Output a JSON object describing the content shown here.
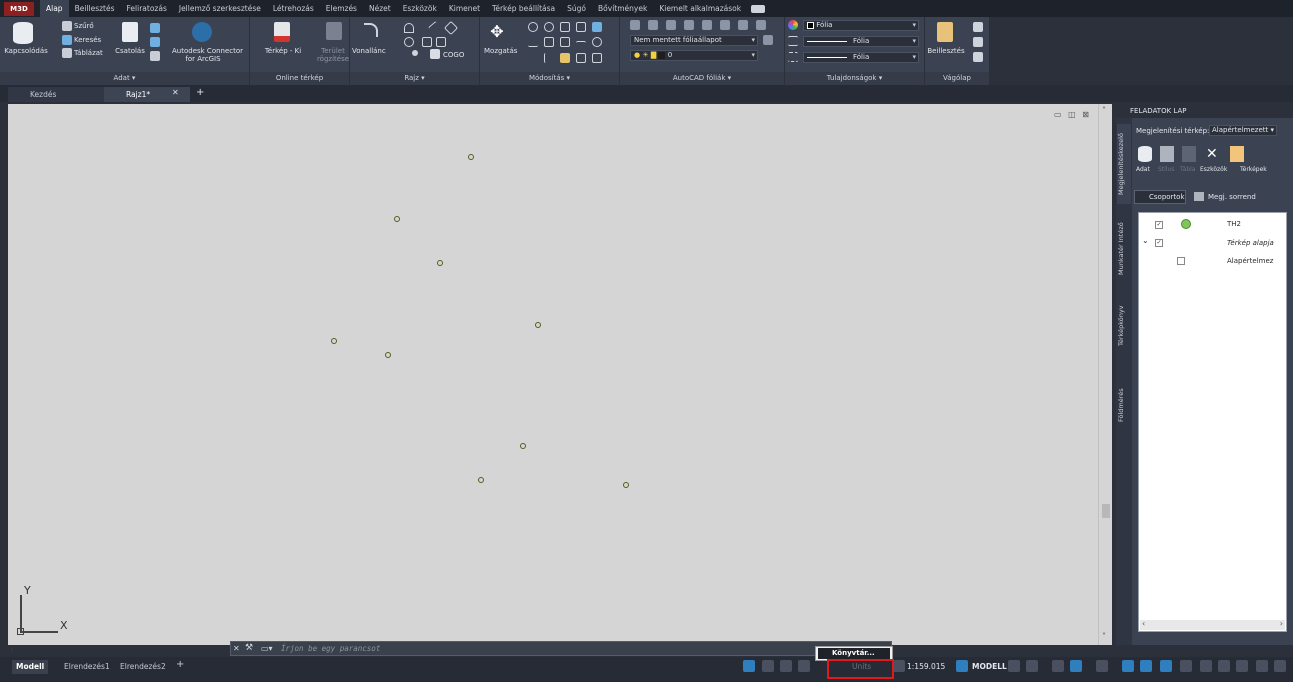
{
  "app": {
    "button_label": "M3D"
  },
  "ribbon_tabs": [
    "Alap",
    "Beillesztés",
    "Feliratozás",
    "Jellemző szerkesztése",
    "Létrehozás",
    "Elemzés",
    "Nézet",
    "Eszközök",
    "Kimenet",
    "Térkép beállítása",
    "Súgó",
    "Bővítmények",
    "Kiemelt alkalmazások"
  ],
  "ribbon": {
    "kapcsolodas": "Kapcsolódás",
    "szuro": "Szűrő",
    "kereses": "Keresés",
    "tablazat": "Táblázat",
    "csatolas": "Csatolás",
    "autodesk_connector": "Autodesk Connector",
    "for_arcgis": "for ArcGIS",
    "terkep_ki": "Térkép - Ki",
    "terulet": "Terület",
    "rogzitese": "rögzítése",
    "vonallanc": "Vonallánc",
    "cogo": "COGO",
    "mozgatas": "Mozgatás",
    "layer_state": "Nem mentett fóliaállapot",
    "layer_zero": "0",
    "folia1": "Fólia",
    "folia2": "Fólia",
    "folia3": "Fólia",
    "beillesztes": "Beillesztés",
    "panel_adat": "Adat",
    "panel_online": "Online térkép",
    "panel_rajz": "Rajz",
    "panel_modositas": "Módosítás",
    "panel_folia": "AutoCAD fóliák",
    "panel_tulajd": "Tulajdonságok",
    "panel_vagolap": "Vágólap"
  },
  "doc_tabs": {
    "start": "Kezdés",
    "drawing": "Rajz1*"
  },
  "ucs": {
    "x": "X",
    "y": "Y"
  },
  "command_line": {
    "placeholder": "Írjon be egy parancsot"
  },
  "layout_tabs": [
    "Modell",
    "Elrendezés1",
    "Elrendezés2"
  ],
  "status": {
    "scale": "1:159.015",
    "model": "MODELL",
    "units": "Units"
  },
  "popup": {
    "item": "Könyvtár..."
  },
  "taskpane": {
    "title": "FELADATOK LAP",
    "map_label": "Megjelenítési térkép:",
    "map_value": "Alapértelmezett",
    "tools": [
      "Adat",
      "Stílus",
      "Tábla",
      "Eszközök",
      "Térképek"
    ],
    "groups_btn": "Csoportok",
    "order_btn": "Megj. sorrend",
    "items": [
      {
        "label": "TH2"
      },
      {
        "label": "Térkép alapja"
      },
      {
        "label": "Alapértelmez"
      }
    ],
    "side_tabs": [
      "Megjelenítéskezelő",
      "Munkatér Intéző",
      "Térképkönyv",
      "Földmérés"
    ]
  }
}
